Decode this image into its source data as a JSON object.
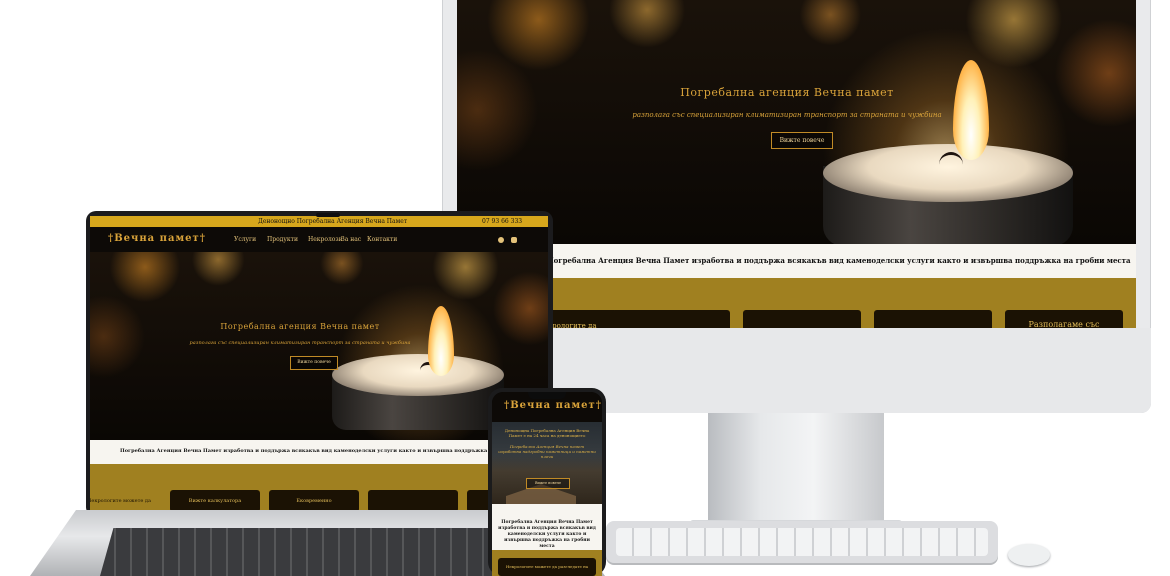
{
  "desktop": {
    "hero": {
      "title": "Погребална агенция Вечна памет",
      "subtitle": "разполага със специализиран климатизиран транспорт за страната и чужбина",
      "button": "Вижте повече"
    },
    "band_text": "Погребална Агенция Вечна Памет изработва и поддържа всякакъв вид каменоделски услуги както и извършва поддръжка на гробни места",
    "cards": [
      "Некрологите да",
      "",
      "",
      "",
      "Разполагаме със"
    ]
  },
  "laptop": {
    "topbar": {
      "left": "Денонощно Погребална Агенция Вечна Памет",
      "phone": "07 93 66 333"
    },
    "logo": "†Вечна памет†",
    "nav": [
      "Услуги",
      "Продукти",
      "Некролози",
      "За нас",
      "Контакти"
    ],
    "social": [
      "facebook-icon",
      "instagram-icon"
    ],
    "hero": {
      "title": "Погребална агенция Вечна памет",
      "subtitle": "разполага със специализиран климатизиран транспорт за страната и чужбина",
      "button": "Вижте повече"
    },
    "band_text": "Погребална Агенция Вечна Памет изработва и поддържа всякакъв вид каменоделски услуги както и извършва поддръжка на гробни места",
    "cards": [
      "Некрологите можете да",
      "Вижте калкулатора",
      "Ековременно",
      "",
      "Р"
    ]
  },
  "phone": {
    "logo": "†Вечна памет†",
    "hero_lines": [
      "Денонощна Погребална Агенция Вечна Памет е на 24 часа на денонощието",
      "Погребална Агенция Вечна памет изработва надгробни паметници и паметни плочи",
      "Вижте повече"
    ],
    "band_text": "Погребална Агенция Вечна Памет изработва и поддържа всякакъв вид каменоделски услуги както и извършва поддръжка на гробни места",
    "card": "Некрологите можете да разгледате на"
  },
  "colors": {
    "gold": "#d9a33a",
    "gold_band": "#a08020",
    "topbar": "#d7a71c",
    "dark": "#0b0805"
  }
}
